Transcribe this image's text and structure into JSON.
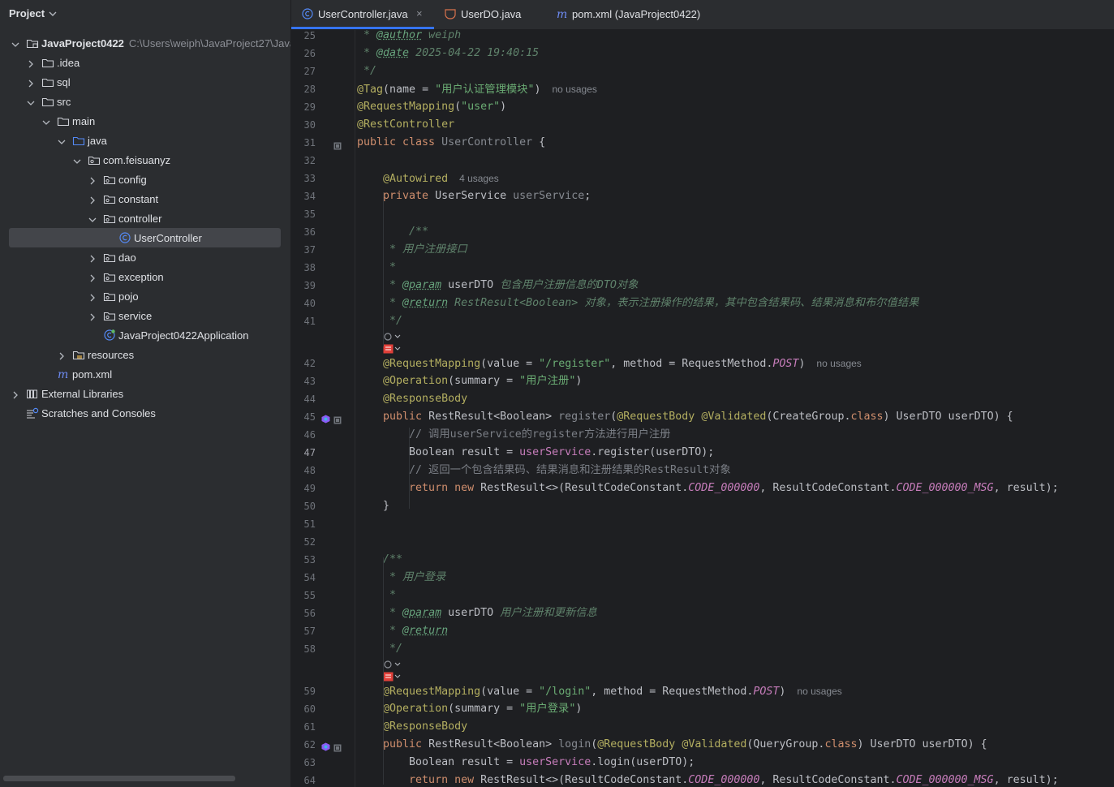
{
  "project_panel": {
    "title": "Project",
    "tree": [
      {
        "name": "JavaProject0422",
        "path": "C:\\Users\\weiph\\JavaProject27\\Java",
        "icon": "module-folder-icon",
        "level": 0,
        "expanded": true
      },
      {
        "name": ".idea",
        "icon": "folder-icon",
        "level": 1,
        "expanded": false
      },
      {
        "name": "sql",
        "icon": "folder-icon",
        "level": 1,
        "expanded": false
      },
      {
        "name": "src",
        "icon": "folder-icon",
        "level": 1,
        "expanded": true
      },
      {
        "name": "main",
        "icon": "folder-icon",
        "level": 2,
        "expanded": true
      },
      {
        "name": "java",
        "icon": "source-folder-icon",
        "level": 3,
        "expanded": true
      },
      {
        "name": "com.feisuanyz",
        "icon": "package-icon",
        "level": 4,
        "expanded": true
      },
      {
        "name": "config",
        "icon": "package-icon",
        "level": 5,
        "expanded": false
      },
      {
        "name": "constant",
        "icon": "package-icon",
        "level": 5,
        "expanded": false
      },
      {
        "name": "controller",
        "icon": "package-icon",
        "level": 5,
        "expanded": true
      },
      {
        "name": "UserController",
        "icon": "class-icon",
        "level": 6,
        "selected": true
      },
      {
        "name": "dao",
        "icon": "package-icon",
        "level": 5,
        "expanded": false
      },
      {
        "name": "exception",
        "icon": "package-icon",
        "level": 5,
        "expanded": false
      },
      {
        "name": "pojo",
        "icon": "package-icon",
        "level": 5,
        "expanded": false
      },
      {
        "name": "service",
        "icon": "package-icon",
        "level": 5,
        "expanded": false
      },
      {
        "name": "JavaProject0422Application",
        "icon": "spring-app-icon",
        "level": 5
      },
      {
        "name": "resources",
        "icon": "resources-folder-icon",
        "level": 3,
        "expanded": false
      },
      {
        "name": "pom.xml",
        "icon": "maven-icon",
        "level": 2
      },
      {
        "name": "External Libraries",
        "icon": "libraries-icon",
        "level": 0,
        "expanded": false
      },
      {
        "name": "Scratches and Consoles",
        "icon": "scratches-icon",
        "level": 0
      }
    ]
  },
  "editor_tabs": [
    {
      "label": "UserController.java",
      "icon": "class-icon",
      "active": true,
      "closable": true
    },
    {
      "label": "UserDO.java",
      "icon": "class-icon"
    },
    {
      "label": "pom.xml (JavaProject0422)",
      "icon": "maven-icon"
    }
  ],
  "current_line": 47,
  "code_lines": [
    {
      "n": 25,
      "tokens": [
        [
          "doc",
          " * "
        ],
        [
          "doctag",
          "@author"
        ],
        [
          "doc",
          " weiph"
        ]
      ]
    },
    {
      "n": 26,
      "tokens": [
        [
          "doc",
          " * "
        ],
        [
          "doctag",
          "@date"
        ],
        [
          "doc",
          " 2025-04-22 19:40:15"
        ]
      ]
    },
    {
      "n": 27,
      "tokens": [
        [
          "doc",
          " */"
        ]
      ]
    },
    {
      "n": 28,
      "tokens": [
        [
          "ann",
          "@Tag"
        ],
        [
          "",
          "(name = "
        ],
        [
          "str",
          "\"用户认证管理模块\""
        ],
        [
          "",
          ")"
        ]
      ],
      "hint": "no usages"
    },
    {
      "n": 29,
      "tokens": [
        [
          "ann",
          "@RequestMapping"
        ],
        [
          "",
          "("
        ],
        [
          "str",
          "\"user\""
        ],
        [
          "",
          ")"
        ]
      ]
    },
    {
      "n": 30,
      "tokens": [
        [
          "ann",
          "@RestController"
        ]
      ]
    },
    {
      "n": 31,
      "tokens": [
        [
          "kw",
          "public class "
        ],
        [
          "grey",
          "UserController"
        ],
        [
          "",
          " {"
        ]
      ],
      "gutter": "structure"
    },
    {
      "n": 32,
      "tokens": []
    },
    {
      "n": 33,
      "tokens": [
        [
          "ann",
          "    @Autowired"
        ]
      ],
      "hint": "4 usages"
    },
    {
      "n": 34,
      "tokens": [
        [
          "kw",
          "    private "
        ],
        [
          "",
          "UserService "
        ],
        [
          "grey",
          "userService"
        ],
        [
          "",
          ";"
        ]
      ]
    },
    {
      "n": 35,
      "tokens": []
    },
    {
      "n": 36,
      "tokens": [
        [
          "doc",
          "        /**"
        ]
      ]
    },
    {
      "n": 37,
      "tokens": [
        [
          "doc",
          "     * 用户注册接口"
        ]
      ]
    },
    {
      "n": 38,
      "tokens": [
        [
          "doc",
          "     *"
        ]
      ]
    },
    {
      "n": 39,
      "tokens": [
        [
          "doc",
          "     * "
        ],
        [
          "doctag",
          "@param"
        ],
        [
          "doc",
          " "
        ],
        [
          "",
          "userDTO"
        ],
        [
          "doc",
          " 包含用户注册信息的DTO对象"
        ]
      ]
    },
    {
      "n": 40,
      "tokens": [
        [
          "doc",
          "     * "
        ],
        [
          "doctag",
          "@return"
        ],
        [
          "doc",
          " RestResult<"
        ],
        [
          "doc",
          "Boolean"
        ],
        [
          "doc",
          "> "
        ],
        [
          "doc",
          "对象，表示注册操作的结果，其中包含结果码、结果消息和布尔值结果"
        ]
      ]
    },
    {
      "n": 41,
      "tokens": [
        [
          "doc",
          "     */"
        ]
      ],
      "extra_gap": true
    },
    {
      "n": 42,
      "tokens": [
        [
          "ann",
          "    @RequestMapping"
        ],
        [
          "",
          "(value = "
        ],
        [
          "str",
          "\"/register\""
        ],
        [
          "",
          ", method = RequestMethod."
        ],
        [
          "stat",
          "POST"
        ],
        [
          "",
          ")"
        ]
      ],
      "hint": "no usages"
    },
    {
      "n": 43,
      "tokens": [
        [
          "ann",
          "    @Operation"
        ],
        [
          "",
          "(summary = "
        ],
        [
          "str",
          "\"用户注册\""
        ],
        [
          "",
          ")"
        ]
      ]
    },
    {
      "n": 44,
      "tokens": [
        [
          "ann",
          "    @ResponseBody"
        ]
      ]
    },
    {
      "n": 45,
      "tokens": [
        [
          "kw",
          "    public "
        ],
        [
          "",
          "RestResult<Boolean> "
        ],
        [
          "grey",
          "register"
        ],
        [
          "",
          "("
        ],
        [
          "ann",
          "@RequestBody"
        ],
        [
          "",
          " "
        ],
        [
          "ann",
          "@Validated"
        ],
        [
          "",
          "(CreateGroup."
        ],
        [
          "kw",
          "class"
        ],
        [
          "",
          ") UserDTO userDTO) {"
        ]
      ],
      "gutter": "endpoint"
    },
    {
      "n": 46,
      "tokens": [
        [
          "cmt",
          "        // 调用userService的register方法进行用户注册"
        ]
      ]
    },
    {
      "n": 47,
      "tokens": [
        [
          "",
          "        Boolean result = "
        ],
        [
          "field",
          "userService"
        ],
        [
          "",
          ".register(userDTO);"
        ]
      ]
    },
    {
      "n": 48,
      "tokens": [
        [
          "cmt",
          "        // 返回一个包含结果码、结果消息和注册结果的RestResult对象"
        ]
      ]
    },
    {
      "n": 49,
      "tokens": [
        [
          "kw",
          "        return new "
        ],
        [
          "",
          "RestResult<>(ResultCodeConstant."
        ],
        [
          "stat",
          "CODE_000000"
        ],
        [
          "",
          ", ResultCodeConstant."
        ],
        [
          "stat",
          "CODE_000000_MSG"
        ],
        [
          "",
          ", result);"
        ]
      ]
    },
    {
      "n": 50,
      "tokens": [
        [
          "",
          "    }"
        ]
      ]
    },
    {
      "n": 51,
      "tokens": []
    },
    {
      "n": 52,
      "tokens": []
    },
    {
      "n": 53,
      "tokens": [
        [
          "doc",
          "    /**"
        ]
      ]
    },
    {
      "n": 54,
      "tokens": [
        [
          "doc",
          "     * 用户登录"
        ]
      ]
    },
    {
      "n": 55,
      "tokens": [
        [
          "doc",
          "     *"
        ]
      ]
    },
    {
      "n": 56,
      "tokens": [
        [
          "doc",
          "     * "
        ],
        [
          "doctag",
          "@param"
        ],
        [
          "doc",
          " "
        ],
        [
          "",
          "userDTO"
        ],
        [
          "doc",
          " 用户注册和更新信息"
        ]
      ]
    },
    {
      "n": 57,
      "tokens": [
        [
          "doc",
          "     * "
        ],
        [
          "doctag",
          "@return"
        ]
      ]
    },
    {
      "n": 58,
      "tokens": [
        [
          "doc",
          "     */"
        ]
      ],
      "extra_gap": true
    },
    {
      "n": 59,
      "tokens": [
        [
          "ann",
          "    @RequestMapping"
        ],
        [
          "",
          "(value = "
        ],
        [
          "str",
          "\"/login\""
        ],
        [
          "",
          ", method = RequestMethod."
        ],
        [
          "stat",
          "POST"
        ],
        [
          "",
          ")"
        ]
      ],
      "hint": "no usages"
    },
    {
      "n": 60,
      "tokens": [
        [
          "ann",
          "    @Operation"
        ],
        [
          "",
          "(summary = "
        ],
        [
          "str",
          "\"用户登录\""
        ],
        [
          "",
          ")"
        ]
      ]
    },
    {
      "n": 61,
      "tokens": [
        [
          "ann",
          "    @ResponseBody"
        ]
      ]
    },
    {
      "n": 62,
      "tokens": [
        [
          "kw",
          "    public "
        ],
        [
          "",
          "RestResult<Boolean> "
        ],
        [
          "grey",
          "login"
        ],
        [
          "",
          "("
        ],
        [
          "ann",
          "@RequestBody"
        ],
        [
          "",
          " "
        ],
        [
          "ann",
          "@Validated"
        ],
        [
          "",
          "(QueryGroup."
        ],
        [
          "kw",
          "class"
        ],
        [
          "",
          ") UserDTO userDTO) {"
        ]
      ],
      "gutter": "endpoint"
    },
    {
      "n": 63,
      "tokens": [
        [
          "",
          "        Boolean result = "
        ],
        [
          "field",
          "userService"
        ],
        [
          "",
          ".login(userDTO);"
        ]
      ]
    },
    {
      "n": 64,
      "tokens": [
        [
          "kw",
          "        return new "
        ],
        [
          "",
          "RestResult<>(ResultCodeConstant."
        ],
        [
          "stat",
          "CODE_000000"
        ],
        [
          "",
          ", ResultCodeConstant."
        ],
        [
          "stat",
          "CODE_000000_MSG"
        ],
        [
          "",
          ", result);"
        ]
      ]
    }
  ],
  "colors": {
    "accent": "#3574f0",
    "background": "#1e1f22",
    "panel": "#2b2d30"
  }
}
